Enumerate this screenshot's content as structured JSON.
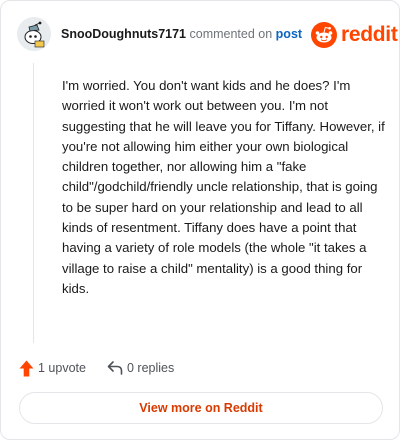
{
  "header": {
    "username": "SnooDoughnuts7171",
    "action_text": "commented on",
    "post_link": "post",
    "brand": "reddit",
    "avatar_icon": "snoo-avatar-icon",
    "logo_icon": "reddit-snoo-logo-icon"
  },
  "comment": {
    "body": "I'm worried. You don't want kids and he does? I'm worried it won't work out between you. I'm not suggesting that he will leave you for Tiffany. However, if you're not allowing him either your own biological children together, nor allowing him a \"fake child\"/godchild/friendly uncle relationship, that is going to be super hard on your relationship and lead to all kinds of resentment. Tiffany does have a point that having a variety of role models (the whole \"it takes a village to raise a child\" mentality) is a good thing for kids."
  },
  "actions": {
    "upvotes": "1 upvote",
    "replies": "0 replies",
    "upvote_icon": "upvote-arrow-icon",
    "reply_icon": "reply-arrow-icon"
  },
  "footer": {
    "view_more": "View more on Reddit"
  },
  "colors": {
    "brand": "#ff4500",
    "link": "#0a66c2",
    "view_more": "#d93a00",
    "border": "#e3e5e8"
  }
}
